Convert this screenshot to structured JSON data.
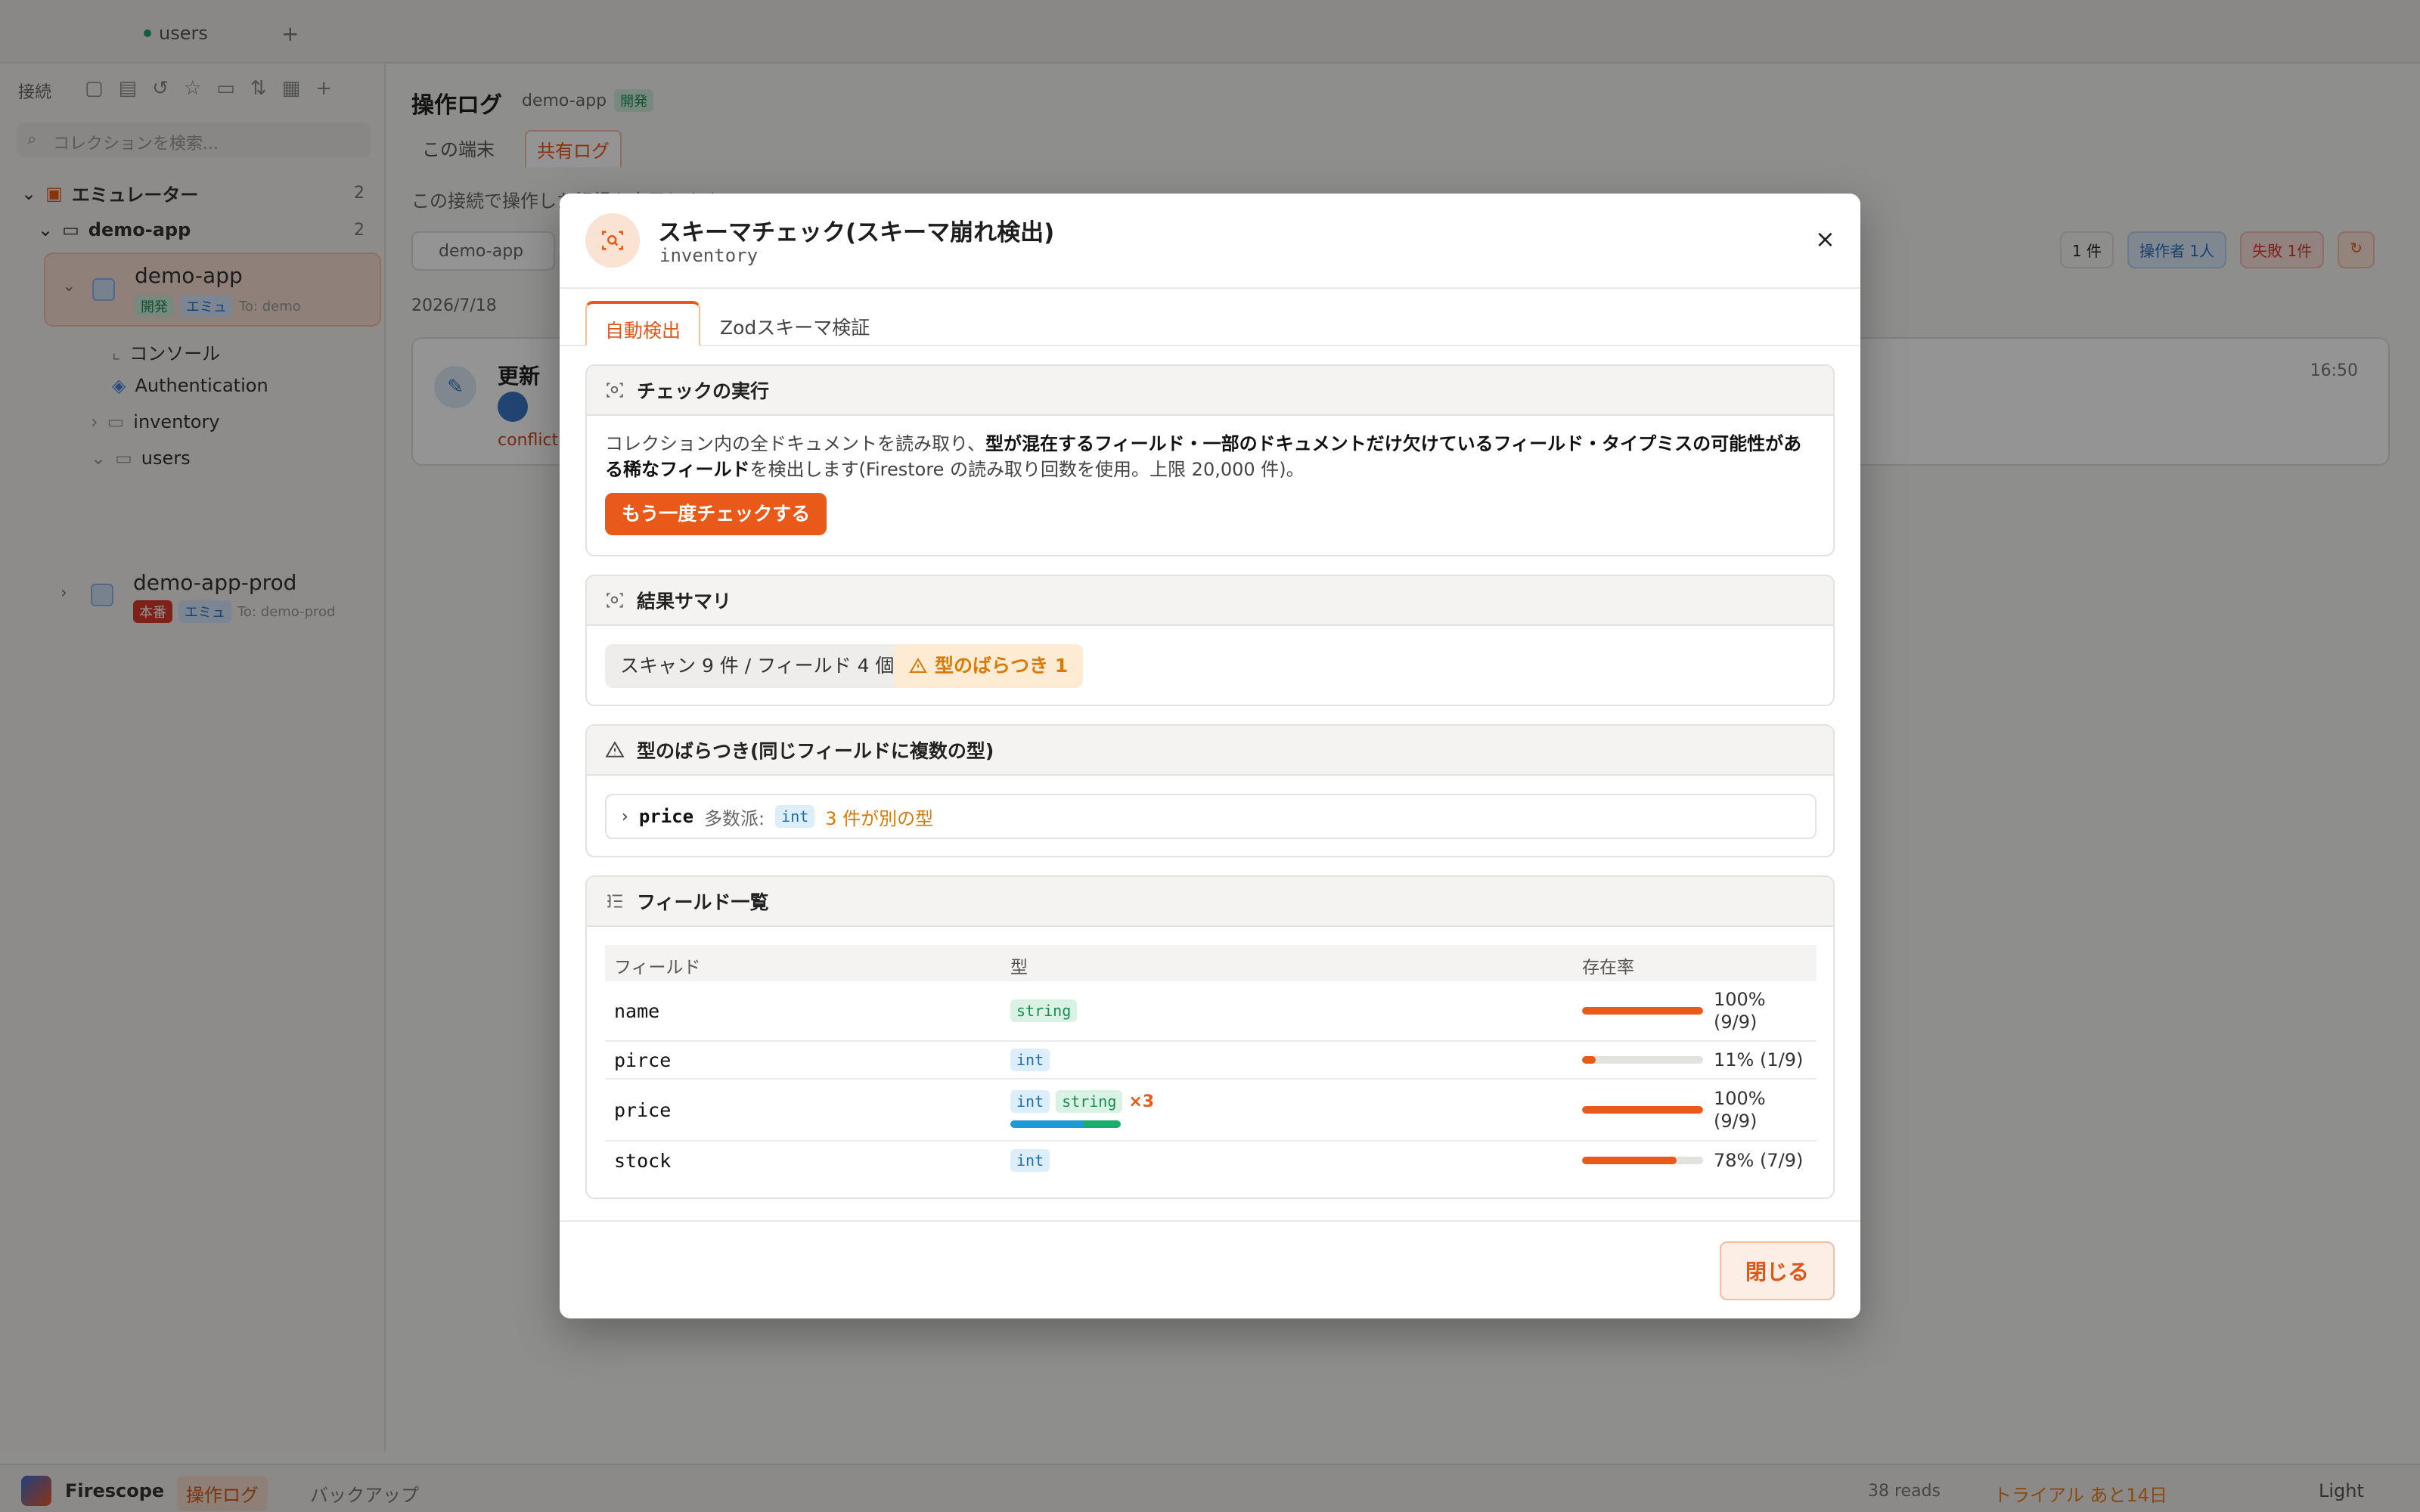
{
  "app": {
    "tab_label": "users",
    "sidebar_label": "接続",
    "search_placeholder": "コレクションを検索...",
    "tree": {
      "emulator": "エミュレーター",
      "emulator_count": "2",
      "demo_folder": "demo-app",
      "demo_folder_count": "2",
      "project_name": "demo-app",
      "project_badge_1": "開発",
      "project_badge_2": "エミュ",
      "project_alias": "To: demo",
      "item_console": "コンソール",
      "item_auth": "Authentication",
      "item_inventory": "inventory",
      "item_users": "users",
      "project2_name": "demo-app-prod",
      "project2_badge_1": "本番",
      "project2_badge_2": "エミュ",
      "project2_alias": "To: demo-prod"
    },
    "main": {
      "title": "操作ログ",
      "project": "demo-app",
      "env_badge": "開発",
      "tab_local": "この端末",
      "tab_shared": "共有ログ",
      "info": "この接続で操作した記録を表示します。",
      "filter": "demo-app",
      "chip_count": "1 件",
      "chip_operator": "操作者 1人",
      "chip_failed": "失敗 1件",
      "date": "2026/7/18",
      "log_title": "更新",
      "log_time": "16:50",
      "log_error": "conflict"
    },
    "statusbar": {
      "brand": "Firescope",
      "oplog": "操作ログ",
      "backup": "バックアップ",
      "reads": "38 reads",
      "trial": "トライアル あと14日",
      "theme": "Light"
    }
  },
  "modal": {
    "title": "スキーマチェック(スキーマ崩れ検出)",
    "collection": "inventory",
    "close_icon": "×",
    "tabs": [
      "自動検出",
      "Zodスキーマ検証"
    ],
    "run_section": {
      "heading": "チェックの実行",
      "desc_prefix": "コレクション内の全ドキュメントを読み取り、",
      "desc_bold": "型が混在するフィールド・一部のドキュメントだけ欠けているフィールド・タイプミスの可能性がある稀なフィールド",
      "desc_suffix": "を検出します(Firestore の読み取り回数を使用。上限 20,000 件)。",
      "button": "もう一度チェックする"
    },
    "summary_section": {
      "heading": "結果サマリ",
      "scan_chip": "スキャン 9 件 / フィールド 4 個",
      "warn_chip": "型のばらつき 1"
    },
    "variance_section": {
      "heading": "型のばらつき(同じフィールドに複数の型)",
      "field": "price",
      "majority_label": "多数派:",
      "majority_type": "int",
      "diff_text": "3 件が別の型"
    },
    "fields_section": {
      "heading": "フィールド一覧",
      "columns": [
        "フィールド",
        "型",
        "存在率"
      ],
      "rows": [
        {
          "name": "name",
          "types": [
            "string"
          ],
          "mix": "",
          "rate": 1.0,
          "rate_text": "100% (9/9)"
        },
        {
          "name": "pirce",
          "types": [
            "int"
          ],
          "mix": "",
          "rate": 0.11,
          "rate_text": "11% (1/9)"
        },
        {
          "name": "price",
          "types": [
            "int",
            "string"
          ],
          "mix": "×3",
          "rate": 1.0,
          "rate_text": "100% (9/9)"
        },
        {
          "name": "stock",
          "types": [
            "int"
          ],
          "mix": "",
          "rate": 0.78,
          "rate_text": "78% (7/9)"
        }
      ]
    },
    "footer": {
      "close_button": "閉じる"
    }
  },
  "colors": {
    "accent": "#e8591a",
    "warning": "#d97a06",
    "int_chip": "#ddeefb",
    "string_chip": "#d9f2e4"
  }
}
